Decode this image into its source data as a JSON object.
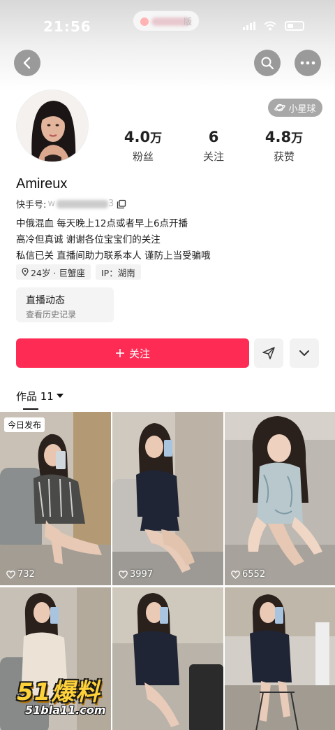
{
  "status_bar": {
    "time": "21:56"
  },
  "island": {
    "text": "版"
  },
  "profile": {
    "planet_label": "小星球",
    "username": "Amireux",
    "id_label": "快手号:",
    "id_visible_prefix": "w",
    "id_visible_suffix": "3",
    "stats": [
      {
        "value": "4.0",
        "unit": "万",
        "label": "粉丝"
      },
      {
        "value": "6",
        "unit": "",
        "label": "关注"
      },
      {
        "value": "4.8",
        "unit": "万",
        "label": "获赞"
      }
    ],
    "bio_lines": [
      "中俄混血 每天晚上12点或者早上6点开播",
      "高冷但真诚 谢谢各位宝宝们的关注",
      "私信已关 直播间助力联系本人 谨防上当受骗哦"
    ],
    "tags": [
      "24岁 · 巨蟹座",
      "IP：湖南"
    ],
    "live_card": {
      "title": "直播动态",
      "subtitle": "查看历史记录"
    }
  },
  "actions": {
    "follow_label": "关注"
  },
  "works": {
    "tab_label": "作品 11",
    "today_badge": "今日发布",
    "items": [
      {
        "likes": "732"
      },
      {
        "likes": "3997"
      },
      {
        "likes": "6552"
      },
      {
        "likes": ""
      },
      {
        "likes": ""
      },
      {
        "likes": ""
      }
    ]
  },
  "watermark": {
    "top": "51爆料",
    "bottom": "51bla11.com"
  },
  "colors": {
    "accent": "#fe2c55",
    "badge": "#a8a8a8",
    "nav_button": "#9a9a9a"
  }
}
